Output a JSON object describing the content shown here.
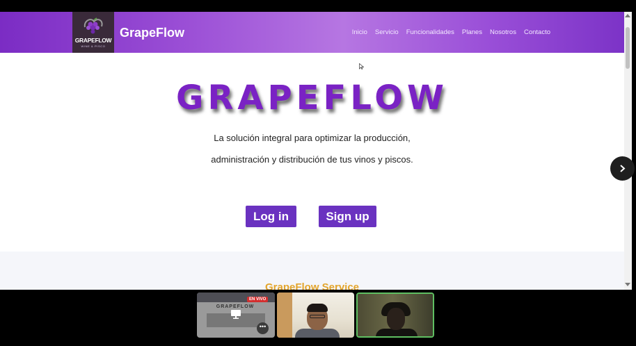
{
  "site": {
    "logo_text": "GRAPEFLOW",
    "logo_subtext": "WINE & PISCO",
    "brand": "GrapeFlow",
    "nav": [
      "Inicio",
      "Servicio",
      "Funcionalidades",
      "Planes",
      "Nosotros",
      "Contacto"
    ]
  },
  "hero": {
    "title": "GRAPEFLOW",
    "tagline_line1": "La solución integral para optimizar la producción,",
    "tagline_line2": "administración y distribución de tus vinos y piscos.",
    "login_label": "Log in",
    "signup_label": "Sign up"
  },
  "section2": {
    "title": "GrapeFlow Service"
  },
  "meeting": {
    "share_thumbnail_title": "GRAPEFLOW",
    "live_badge": "EN VIVO",
    "more_label": "•••"
  },
  "colors": {
    "accent": "#6a32c0",
    "navbar": "#9b4fd6",
    "section_title": "#e3a52c"
  },
  "icons": [
    "chevron-right-icon",
    "presentation-icon",
    "more-icon",
    "grapes-logo-icon",
    "cursor-icon"
  ]
}
